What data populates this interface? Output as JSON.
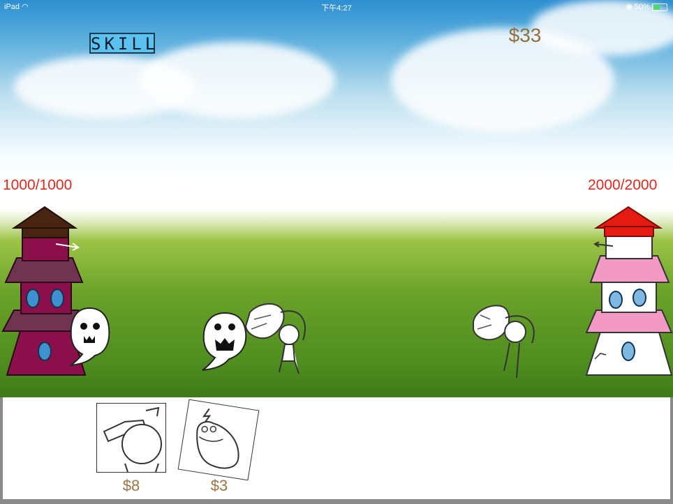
{
  "status_bar": {
    "device": "iPad",
    "time": "下午4:27",
    "battery": "50%",
    "battery_level": 0.5
  },
  "hud": {
    "skill_label": "SKILL",
    "money": "$33"
  },
  "towers": {
    "left": {
      "hp": "1000/1000",
      "hp_value": 1000,
      "hp_max": 1000
    },
    "right": {
      "hp": "2000/2000",
      "hp_value": 2000,
      "hp_max": 2000
    }
  },
  "shop": {
    "cards": [
      {
        "name": "swordsman-card",
        "price": "$8"
      },
      {
        "name": "frog-card",
        "price": "$3"
      }
    ]
  },
  "colors": {
    "sky": "#4aa5dc",
    "grass": "#5a9a24",
    "skill_button": "#5bc1ef",
    "hp_text": "#e0271f",
    "money_text": "#8e6e44",
    "left_tower": "#8a0f4a",
    "right_tower_roof": "#e51b12",
    "right_tower_band": "#f29ac4"
  }
}
